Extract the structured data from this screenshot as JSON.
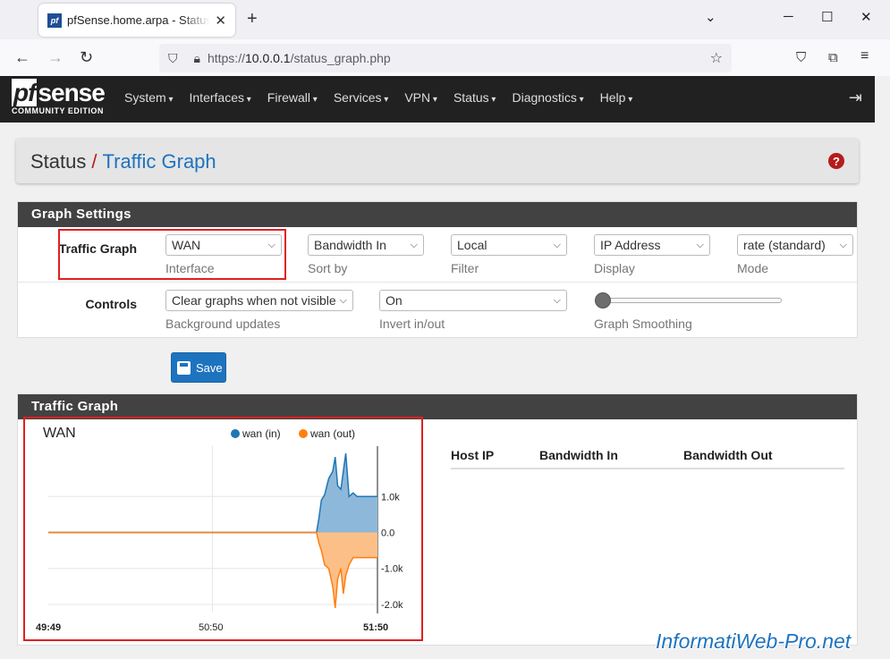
{
  "browser": {
    "tab_title": "pfSense.home.arpa - Status: Traffic Graph",
    "favicon_text": "pf",
    "url_prefix": "https://",
    "url_host": "10.0.0.1",
    "url_path": "/status_graph.php"
  },
  "header": {
    "logo_pf": "pf",
    "logo_sense": "sense",
    "logo_sub": "COMMUNITY EDITION",
    "menu": [
      "System",
      "Interfaces",
      "Firewall",
      "Services",
      "VPN",
      "Status",
      "Diagnostics",
      "Help"
    ]
  },
  "breadcrumb": {
    "section": "Status",
    "separator": "/",
    "page": "Traffic Graph",
    "help": "?"
  },
  "settings": {
    "title": "Graph Settings",
    "row1_label": "Traffic Graph",
    "interface": {
      "value": "WAN",
      "hint": "Interface"
    },
    "sort": {
      "value": "Bandwidth In",
      "hint": "Sort by"
    },
    "filter": {
      "value": "Local",
      "hint": "Filter"
    },
    "display": {
      "value": "IP Address",
      "hint": "Display"
    },
    "mode": {
      "value": "rate (standard)",
      "hint": "Mode"
    },
    "row2_label": "Controls",
    "background": {
      "value": "Clear graphs when not visible",
      "hint": "Background updates"
    },
    "invert": {
      "value": "On",
      "hint": "Invert in/out"
    },
    "smoothing": {
      "hint": "Graph Smoothing",
      "level": 0
    }
  },
  "save_label": "Save",
  "graph_panel": {
    "title": "Traffic Graph",
    "host_columns": [
      "Host IP",
      "Bandwidth In",
      "Bandwidth Out"
    ]
  },
  "chart_data": {
    "type": "area",
    "title": "WAN",
    "series": [
      {
        "name": "wan (in)",
        "color": "#1f77b4",
        "fill": "#8db8d9",
        "points": [
          [
            0,
            0
          ],
          [
            330,
            0
          ],
          [
            333,
            400
          ],
          [
            336,
            900
          ],
          [
            340,
            1050
          ],
          [
            345,
            1500
          ],
          [
            350,
            1700
          ],
          [
            353,
            2100
          ],
          [
            356,
            1300
          ],
          [
            360,
            1200
          ],
          [
            363,
            1700
          ],
          [
            366,
            2200
          ],
          [
            370,
            1000
          ],
          [
            375,
            1100
          ],
          [
            380,
            1000
          ],
          [
            390,
            1000
          ],
          [
            400,
            1000
          ],
          [
            405,
            1000
          ]
        ]
      },
      {
        "name": "wan (out)",
        "color": "#ff7f0e",
        "fill": "#fdbf88",
        "points": [
          [
            0,
            0
          ],
          [
            330,
            0
          ],
          [
            333,
            -300
          ],
          [
            336,
            -500
          ],
          [
            340,
            -900
          ],
          [
            345,
            -1000
          ],
          [
            350,
            -1500
          ],
          [
            353,
            -2100
          ],
          [
            356,
            -1300
          ],
          [
            360,
            -1000
          ],
          [
            363,
            -1700
          ],
          [
            366,
            -1200
          ],
          [
            370,
            -900
          ],
          [
            375,
            -700
          ],
          [
            380,
            -700
          ],
          [
            390,
            -700
          ],
          [
            400,
            -700
          ],
          [
            405,
            -700
          ]
        ]
      }
    ],
    "y_ticks": [
      "1.0k",
      "0.0",
      "-1.0k",
      "-2.0k"
    ],
    "y_values": [
      1000,
      0,
      -1000,
      -2000
    ],
    "x_ticks": [
      "49:49",
      "50:50",
      "51:50"
    ],
    "ylim": [
      -2200,
      2400
    ]
  },
  "watermark": "InformatiWeb-Pro.net"
}
